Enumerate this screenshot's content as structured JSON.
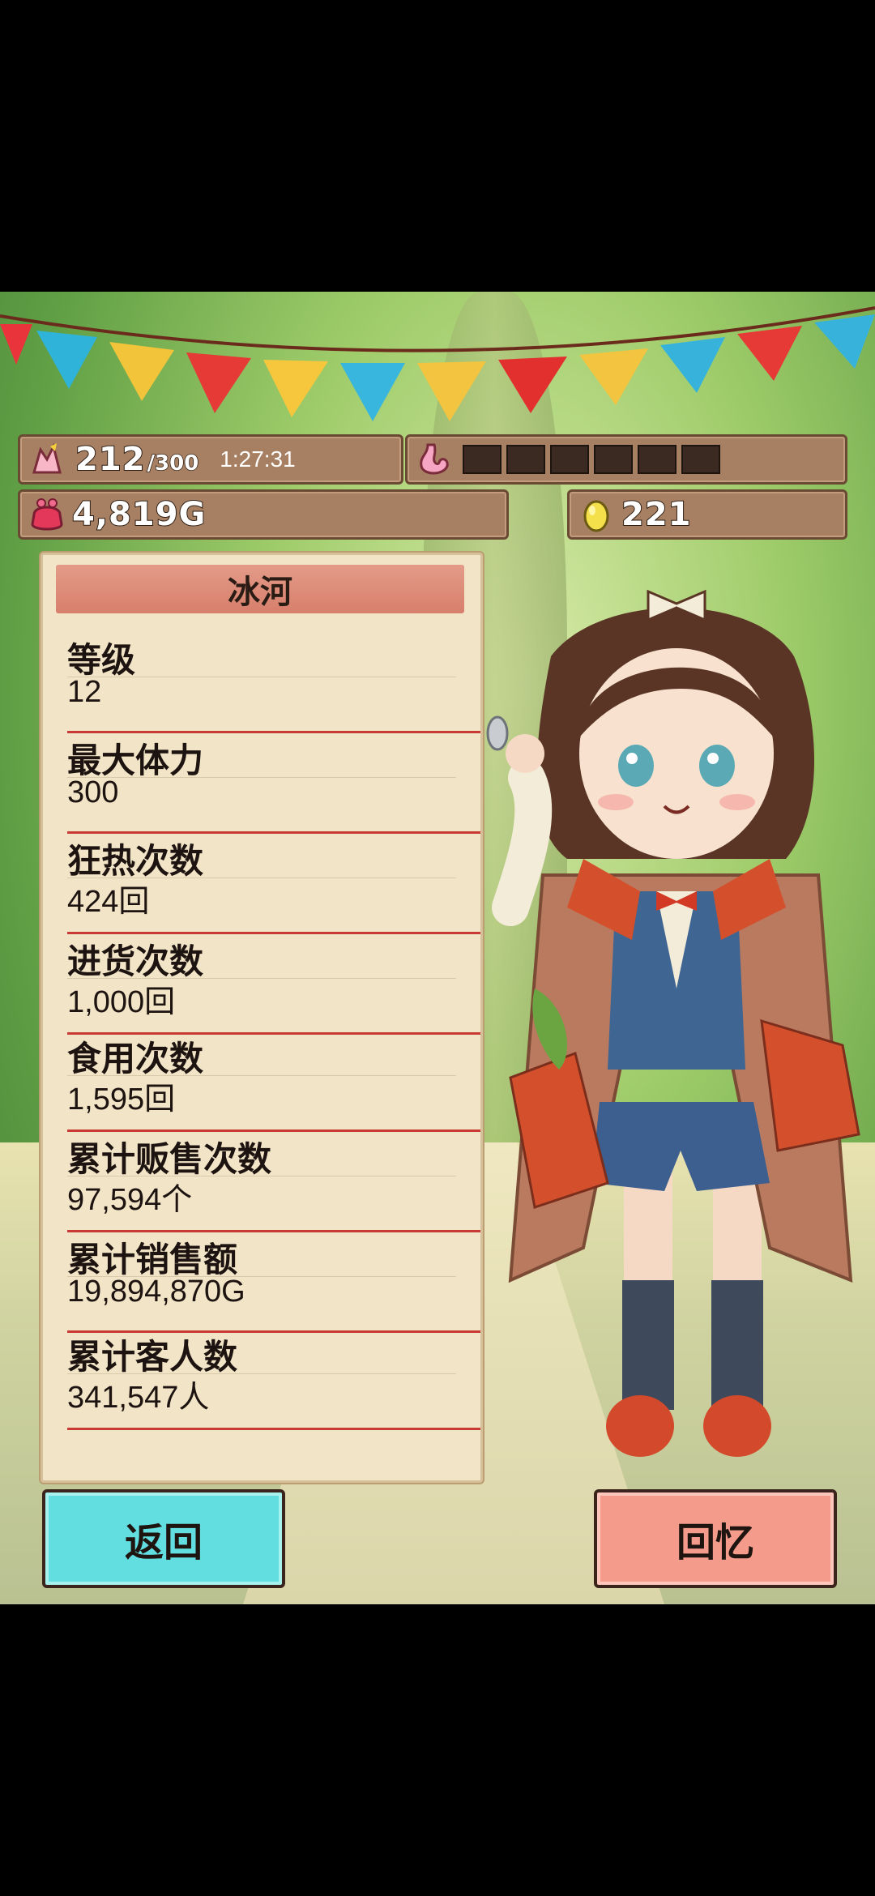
{
  "hud": {
    "stamina_current": "212",
    "stamina_max": "/300",
    "timer": "1:27:31",
    "stomach_segments": 6,
    "gold": "4,819G",
    "eggs": "221"
  },
  "profile": {
    "name": "冰河",
    "stats": [
      {
        "label": "等级",
        "value": "12"
      },
      {
        "label": "最大体力",
        "value": "300"
      },
      {
        "label": "狂热次数",
        "value": "424回"
      },
      {
        "label": "进货次数",
        "value": "1,000回"
      },
      {
        "label": "食用次数",
        "value": "1,595回"
      },
      {
        "label": "累计贩售次数",
        "value": "97,594个"
      },
      {
        "label": "累计销售额",
        "value": "19,894,870G"
      },
      {
        "label": "累计客人数",
        "value": "341,547人"
      }
    ]
  },
  "buttons": {
    "back": "返回",
    "memory": "回忆"
  },
  "colors": {
    "back_button": "#62dde0",
    "memory_button": "#f59b8c",
    "divider": "#c93a35"
  },
  "icons": [
    "stamina-icon",
    "stomach-icon",
    "purse-icon",
    "egg-icon"
  ]
}
